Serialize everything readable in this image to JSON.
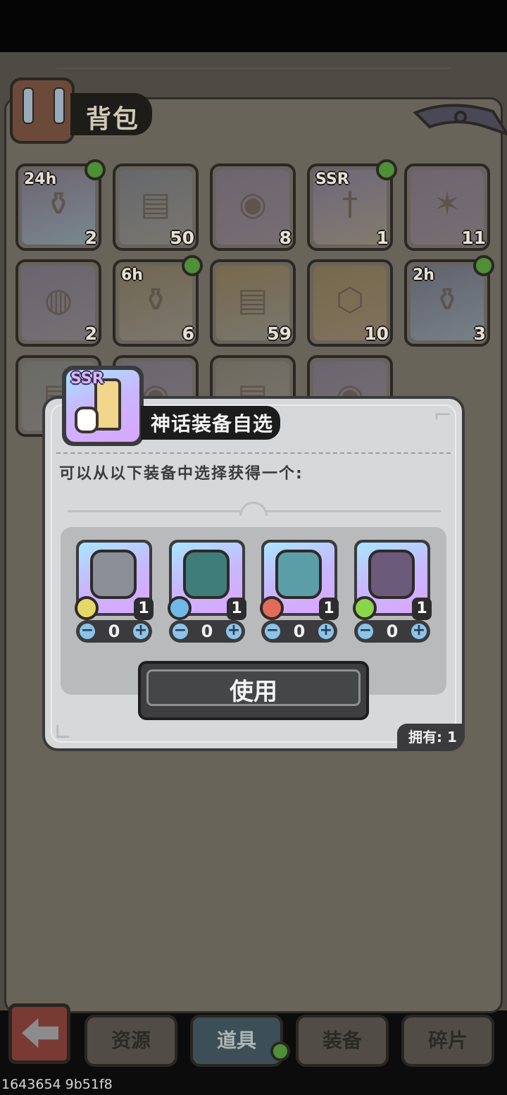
{
  "bag": {
    "title": "背包"
  },
  "grid": {
    "rows": [
      [
        {
          "tag": "24h",
          "count": "2",
          "dot": true,
          "colors": [
            "#6f6576",
            "#7b8e98"
          ],
          "icon": "potion-bottle-icon"
        },
        {
          "tag": "",
          "count": "50",
          "dot": false,
          "colors": [
            "#65686e",
            "#7c7a73"
          ],
          "icon": "spell-book-icon"
        },
        {
          "tag": "",
          "count": "8",
          "dot": false,
          "colors": [
            "#6e6572",
            "#7a7078"
          ],
          "icon": "armor-orb-icon"
        },
        {
          "tag": "SSR",
          "count": "1",
          "dot": true,
          "colors": [
            "#6f6880",
            "#887f70"
          ],
          "icon": "ssr-sword-icon"
        },
        {
          "tag": "",
          "count": "11",
          "dot": false,
          "colors": [
            "#6f6572",
            "#7a7078"
          ],
          "icon": "star-orb-icon"
        }
      ],
      [
        {
          "tag": "",
          "count": "2",
          "dot": false,
          "colors": [
            "#6a6573",
            "#777377"
          ],
          "icon": "mask-icon"
        },
        {
          "tag": "6h",
          "count": "6",
          "dot": true,
          "colors": [
            "#726850",
            "#807a72"
          ],
          "icon": "potion-bottle-icon"
        },
        {
          "tag": "",
          "count": "59",
          "dot": false,
          "colors": [
            "#7a6a48",
            "#7c7a73"
          ],
          "icon": "spell-book-icon"
        },
        {
          "tag": "",
          "count": "10",
          "dot": false,
          "colors": [
            "#7a6a48",
            "#857460"
          ],
          "icon": "key-shield-icon"
        },
        {
          "tag": "2h",
          "count": "3",
          "dot": true,
          "colors": [
            "#5f6270",
            "#7a8590"
          ],
          "icon": "potion-bottle-icon"
        }
      ],
      [
        {
          "tag": "",
          "count": "",
          "dot": false,
          "colors": [
            "#6a6d64",
            "#777377"
          ],
          "icon": "book-icon"
        },
        {
          "tag": "",
          "count": "",
          "dot": false,
          "colors": [
            "#6a6573",
            "#777377"
          ],
          "icon": "orb-icon"
        },
        {
          "tag": "",
          "count": "",
          "dot": false,
          "colors": [
            "#6f6a60",
            "#7c7a73"
          ],
          "icon": "book-icon"
        },
        {
          "tag": "",
          "count": "",
          "dot": false,
          "colors": [
            "#6a6573",
            "#777377"
          ],
          "icon": "orb-icon"
        }
      ]
    ]
  },
  "modal": {
    "title": "神话装备自选",
    "header_icon_tag": "SSR",
    "description": "可以从以下装备中选择获得一个:",
    "items": [
      {
        "count": "1",
        "qty": "0",
        "element_color": "#e6d866",
        "art_color": "#8a8f98",
        "icon": "armor-chestplate-icon",
        "element": "earth-element-icon"
      },
      {
        "count": "1",
        "qty": "0",
        "element_color": "#6fb8e8",
        "art_color": "#3f7d7a",
        "icon": "ring-icon",
        "element": "water-element-icon"
      },
      {
        "count": "1",
        "qty": "0",
        "element_color": "#e46a5a",
        "art_color": "#5b9ea8",
        "icon": "sword-icon",
        "element": "fire-element-icon"
      },
      {
        "count": "1",
        "qty": "0",
        "element_color": "#8ad64a",
        "art_color": "#6b5a7a",
        "icon": "helmet-icon",
        "element": "wind-element-icon"
      }
    ],
    "minus": "−",
    "plus": "+",
    "use_label": "使用",
    "owned_label": "拥有: 1"
  },
  "tabs": [
    {
      "label": "资源",
      "active": false
    },
    {
      "label": "道具",
      "active": true
    },
    {
      "label": "装备",
      "active": false
    },
    {
      "label": "碎片",
      "active": false
    }
  ],
  "watermark": "1643654 9b51f8"
}
